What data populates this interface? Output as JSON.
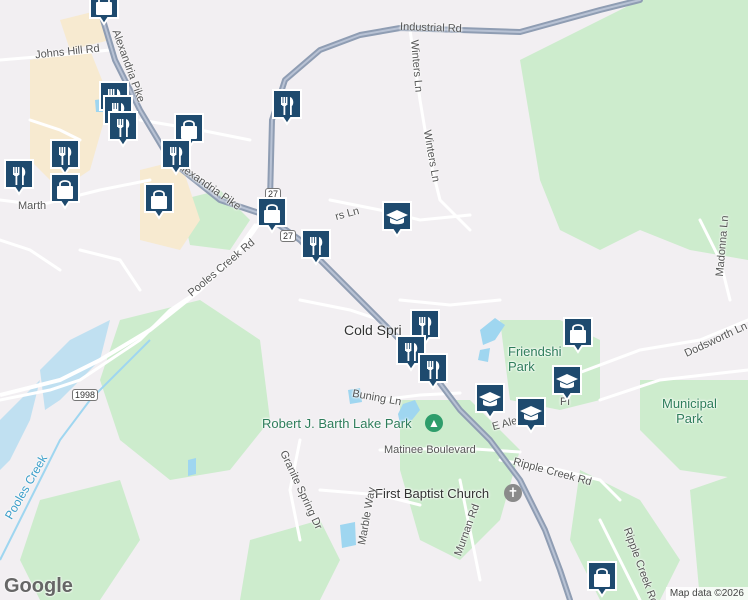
{
  "map": {
    "labels": {
      "industrial_rd": "Industrial Rd",
      "winters_ln_top": "Winters Ln",
      "winters_ln_mid": "Winters Ln",
      "johns_hill_rd": "Johns Hill Rd",
      "alexandria_pike_n": "Alexandria Pike",
      "alexandria_pike_s": "Alexandria Pike",
      "pooles_creek_rd": "Pooles Creek Rd",
      "pooles_creek": "Pooles Creek",
      "marth": "Marth",
      "rs_ln": "rs Ln",
      "cold_spring": "Cold Spri",
      "friendship_park": "Friendshi\nPark",
      "municipal_park": "Municipal\nPark",
      "dodsworth_ln": "Dodsworth Ln",
      "madonna_ln": "Madonna Ln",
      "buning_ln": "Buning Ln",
      "robert_barth_park": "Robert J. Barth Lake Park",
      "matinee_blvd": "Matinee Boulevard",
      "e_alex": "E Ale",
      "pi": "Pi",
      "ripple_creek_rd": "Ripple Creek Rd",
      "ripple_creek_rd_s": "Ripple Creek Rd",
      "first_baptist": "First Baptist Church",
      "granite_spring_dr": "Granite Spring Dr",
      "marble_way": "Marble Way",
      "murnan_rd": "Murnan Rd"
    },
    "shields": {
      "route_1998": "1998",
      "route_27a": "27",
      "route_27b": "27"
    },
    "footer": {
      "google_logo": "Google",
      "attribution": "Map data ©2026"
    },
    "colors": {
      "background": "#f2eff2",
      "park_green": "#cdeccd",
      "water_blue": "#9fd6f0",
      "highway": "#8f9db3",
      "road": "#ffffff",
      "marker_blue": "#1e4a6e",
      "land_use": "#f7ead0"
    },
    "markers": [
      {
        "id": "m1",
        "icon": "shopping-bag"
      },
      {
        "id": "m2",
        "icon": "restaurant"
      },
      {
        "id": "m3",
        "icon": "restaurant"
      },
      {
        "id": "m4",
        "icon": "restaurant"
      },
      {
        "id": "m5",
        "icon": "shopping-bag"
      },
      {
        "id": "m6",
        "icon": "restaurant"
      },
      {
        "id": "m7",
        "icon": "restaurant"
      },
      {
        "id": "m8",
        "icon": "restaurant"
      },
      {
        "id": "m9",
        "icon": "shopping-bag"
      },
      {
        "id": "m10",
        "icon": "shopping-bag"
      },
      {
        "id": "m11",
        "icon": "restaurant"
      },
      {
        "id": "m12",
        "icon": "shopping-bag"
      },
      {
        "id": "m13",
        "icon": "restaurant"
      },
      {
        "id": "m14",
        "icon": "school"
      },
      {
        "id": "m15",
        "icon": "restaurant"
      },
      {
        "id": "m16",
        "icon": "restaurant"
      },
      {
        "id": "m17",
        "icon": "restaurant"
      },
      {
        "id": "m18",
        "icon": "shopping-bag"
      },
      {
        "id": "m19",
        "icon": "school"
      },
      {
        "id": "m20",
        "icon": "school"
      },
      {
        "id": "m21",
        "icon": "school"
      },
      {
        "id": "m22",
        "icon": "shopping-bag"
      },
      {
        "id": "m23",
        "icon": "park"
      },
      {
        "id": "m24",
        "icon": "church"
      }
    ]
  }
}
